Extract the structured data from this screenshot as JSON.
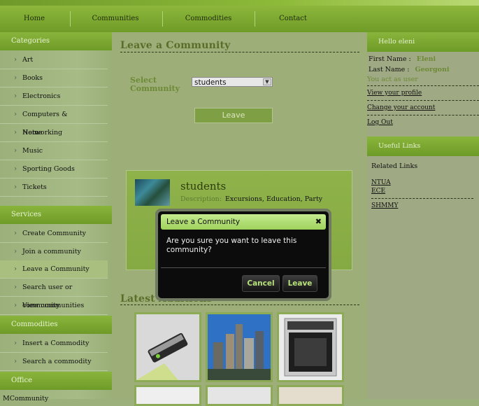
{
  "nav": {
    "items": [
      "Home",
      "Communities",
      "Commodities",
      "Contact"
    ]
  },
  "sidebar": {
    "categories_title": "Categories",
    "categories": [
      "Art",
      "Books",
      "Electronics",
      "Computers & Networking",
      "Home",
      "Music",
      "Sporting Goods",
      "Tickets"
    ],
    "services_title": "Services",
    "services": [
      "Create Community",
      "Join a community",
      "Leave a Community",
      "Search user or community",
      "View communities"
    ],
    "commodities_title": "Commodities",
    "commodities": [
      "Insert a Commodity",
      "Search a commodity"
    ],
    "office_title": "Office",
    "office_cut": "MCommunity"
  },
  "main": {
    "title": "Leave a Community",
    "select_label": "Select Community",
    "select_value": "students",
    "leave_button": "Leave",
    "community": {
      "name": "students",
      "desc_label": "Description:",
      "desc_value": "Excursions, Education, Party"
    },
    "latest_title": "Latest Additions"
  },
  "right": {
    "hello": "Hello eleni",
    "first_label": "First Name :",
    "first_value": "Eleni",
    "last_label": "Last Name :",
    "last_value": "Georgoni",
    "act_as": "You act as user",
    "links": [
      "View your profile",
      "Change your account",
      "Log Out"
    ],
    "useful_title": "Useful Links",
    "related_title": "Related Links",
    "related": [
      "NTUA",
      "ECE",
      "SHMMY"
    ]
  },
  "dialog": {
    "title": "Leave a Community",
    "message": "Are you sure you want to leave this community?",
    "cancel": "Cancel",
    "leave": "Leave"
  },
  "colors": {
    "accent": "#8ab53c",
    "dialog_title": "#b4e07a",
    "button_text": "#b7e27a"
  }
}
